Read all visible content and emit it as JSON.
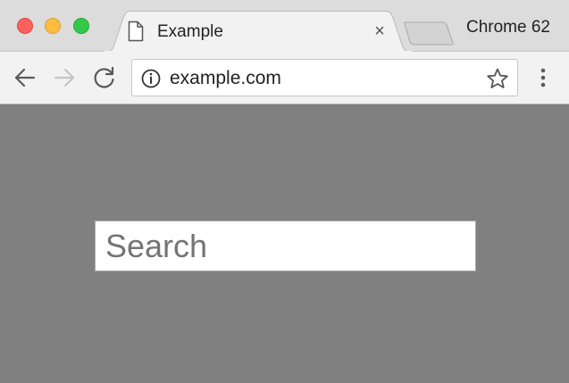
{
  "window": {
    "controls": [
      "close",
      "minimize",
      "maximize"
    ]
  },
  "tab": {
    "title": "Example",
    "icon": "document-icon",
    "close_label": "×"
  },
  "browser_label": "Chrome 62",
  "toolbar": {
    "back_icon": "back-arrow-icon",
    "forward_icon": "forward-arrow-icon",
    "reload_icon": "reload-icon",
    "url": "example.com",
    "site_info_icon": "info-icon",
    "bookmark_icon": "star-icon",
    "menu_icon": "more-vertical-icon"
  },
  "page": {
    "search": {
      "placeholder": "Search",
      "value": ""
    }
  },
  "colors": {
    "page_background": "#808080",
    "titlebar_background": "#dcdcdc",
    "toolbar_background": "#f2f2f2",
    "close_button": "#fc605c",
    "minimize_button": "#fdbc40",
    "maximize_button": "#34c84a"
  }
}
